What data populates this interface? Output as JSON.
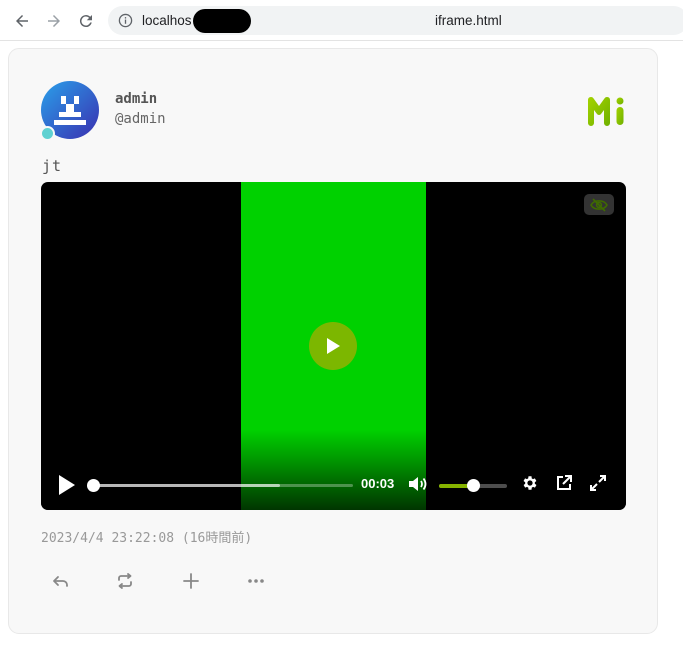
{
  "browser": {
    "url_prefix": "localhos",
    "url_suffix": "iframe.html"
  },
  "note": {
    "user": {
      "display_name": "admin",
      "username": "@admin",
      "online_color": "#5fd1d1"
    },
    "text": "jt",
    "timestamp": "2023/4/4 23:22:08 (16時間前)",
    "media": {
      "type": "video",
      "current_time": "00:03",
      "progress": 0.0,
      "buffered": 0.72,
      "volume": 0.5,
      "accent_color": "#86b300"
    },
    "icons": {
      "instance": "misskey-logo-icon",
      "reply": "reply-icon",
      "renote": "repeat-icon",
      "reaction": "plus-icon",
      "more": "more-icon"
    }
  }
}
